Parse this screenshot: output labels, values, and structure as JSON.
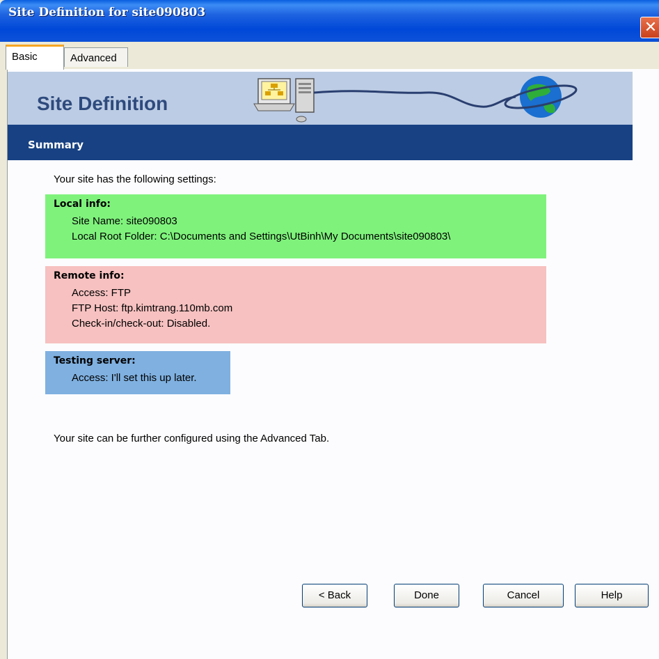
{
  "window": {
    "title": "Site Definition for site090803",
    "close_glyph": "✕"
  },
  "tabs": [
    {
      "label": "Basic",
      "active": true
    },
    {
      "label": "Advanced",
      "active": false
    }
  ],
  "banner": {
    "title": "Site Definition"
  },
  "section": {
    "title": "Summary"
  },
  "intro": "Your site has the following settings:",
  "local_info": {
    "heading": "Local info:",
    "lines": [
      "Site Name: site090803",
      "Local Root Folder: C:\\Documents and Settings\\UtBinh\\My Documents\\site090803\\"
    ]
  },
  "remote_info": {
    "heading": "Remote info:",
    "lines": [
      "Access: FTP",
      "FTP Host: ftp.kimtrang.110mb.com",
      "Check-in/check-out: Disabled."
    ]
  },
  "testing_server": {
    "heading": "Testing server:",
    "lines": [
      "Access: I'll set this up later."
    ]
  },
  "footer_note": "Your site can be further configured using the Advanced Tab.",
  "buttons": {
    "back": "< Back",
    "done": "Done",
    "cancel": "Cancel",
    "help": "Help"
  },
  "colors": {
    "local_box": "#7ff27c",
    "remote_box": "#f6c1c0",
    "testing_box": "#7fb0e0",
    "summary_bar": "#174182",
    "banner": "#bccce4"
  }
}
